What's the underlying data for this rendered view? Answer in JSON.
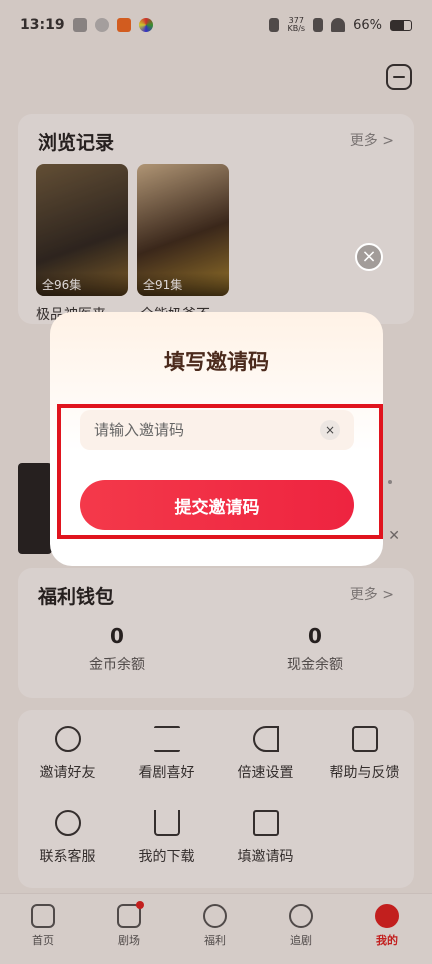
{
  "status_bar": {
    "time": "13:19",
    "net_speed_value": "377",
    "net_speed_unit": "KB/s",
    "battery": "66%"
  },
  "history": {
    "title": "浏览记录",
    "more": "更多 >",
    "items": [
      {
        "episodes": "全96集",
        "title": "极品神医来"
      },
      {
        "episodes": "全91集",
        "title": "全能奶爸不"
      }
    ]
  },
  "wallet": {
    "title": "福利钱包",
    "more": "更多 >",
    "coin_value": "0",
    "coin_label": "金币余额",
    "cash_value": "0",
    "cash_label": "现金余额"
  },
  "tools": [
    {
      "label": "邀请好友",
      "icon": "lightbulb-icon"
    },
    {
      "label": "看剧喜好",
      "icon": "sliders-icon"
    },
    {
      "label": "倍速设置",
      "icon": "fast-forward-icon"
    },
    {
      "label": "帮助与反馈",
      "icon": "message-icon"
    },
    {
      "label": "联系客服",
      "icon": "headset-icon"
    },
    {
      "label": "我的下载",
      "icon": "download-icon"
    },
    {
      "label": "填邀请码",
      "icon": "invite-code-icon"
    }
  ],
  "nav": [
    {
      "label": "首页",
      "icon": "home-icon"
    },
    {
      "label": "剧场",
      "icon": "play-icon"
    },
    {
      "label": "福利",
      "icon": "gift-icon"
    },
    {
      "label": "追剧",
      "icon": "star-icon"
    },
    {
      "label": "我的",
      "icon": "user-icon"
    }
  ],
  "dialog": {
    "title": "填写邀请码",
    "input_placeholder": "请输入邀请码",
    "submit_label": "提交邀请码",
    "clear_glyph": "×"
  },
  "colors": {
    "accent": "#ee2440",
    "highlight": "#e0141e",
    "dialog_title": "#4b2a1c"
  }
}
